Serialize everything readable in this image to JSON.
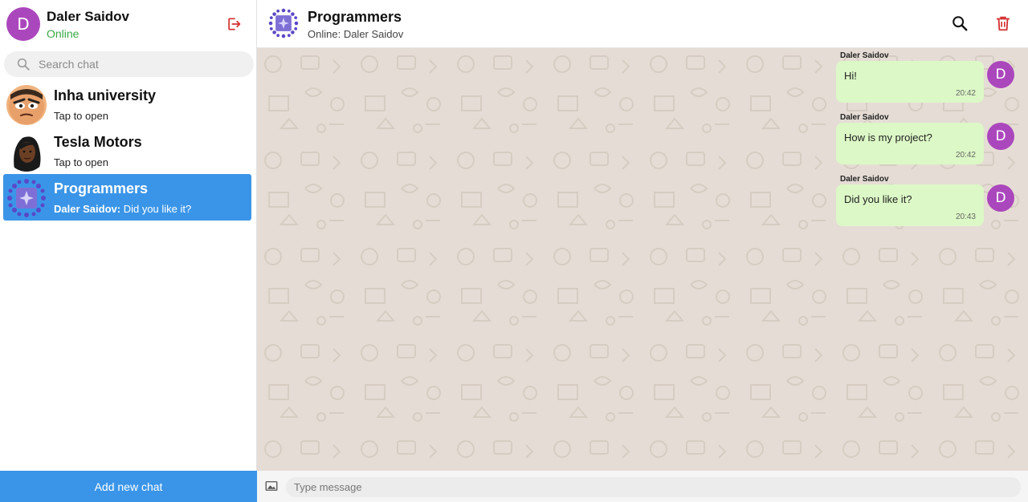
{
  "profile": {
    "avatar_letter": "D",
    "name": "Daler Saidov",
    "status": "Online"
  },
  "search": {
    "placeholder": "Search chat"
  },
  "chats": [
    {
      "title": "Inha university",
      "subtitle": "Tap to open",
      "active": false
    },
    {
      "title": "Tesla Motors",
      "subtitle": "Tap to open",
      "active": false
    },
    {
      "title": "Programmers",
      "subtitle_sender": "Daler Saidov:",
      "subtitle": " Did you like it?",
      "active": true
    }
  ],
  "add_chat_label": "Add new chat",
  "header": {
    "title": "Programmers",
    "online_label": "Online:",
    "online_user": " Daler Saidov"
  },
  "messages": [
    {
      "sender": "Daler Saidov",
      "text": "Hi!",
      "time": "20:42",
      "avatar_letter": "D"
    },
    {
      "sender": "Daler Saidov",
      "text": "How is my project?",
      "time": "20:42",
      "avatar_letter": "D"
    },
    {
      "sender": "Daler Saidov",
      "text": "Did you like it?",
      "time": "20:43",
      "avatar_letter": "D"
    }
  ],
  "composer": {
    "placeholder": "Type message"
  },
  "icons": {
    "logout": "logout-icon",
    "search": "search-icon",
    "delete": "trash-icon",
    "image": "image-icon"
  },
  "colors": {
    "accent": "#3a95e8",
    "avatar": "#ab47bc",
    "online": "#3aa846",
    "bubble": "#dcf8c6",
    "chat_background": "#e5ddd5",
    "delete": "#d32f2f"
  }
}
